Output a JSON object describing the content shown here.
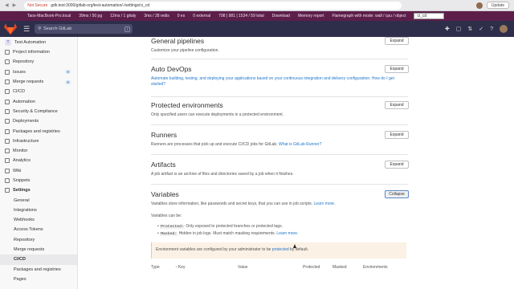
{
  "browser": {
    "not_secure": "Not Secure",
    "url": "gdk.test:3000/gitlab-org/test-automation/-/settings/ci_cd",
    "update": "Update"
  },
  "perf": {
    "items": [
      "Taos-MacBook-Pro.local",
      "39ms / 50 pg",
      "12ms / 1 gitaly",
      "3ms / 28 redis",
      "0 es",
      "0 external",
      "798 | 981 | 1534 / 59 total",
      "Download",
      "Memory report",
      "Flamegraph with mode: wall / cpu / object"
    ],
    "select": "ci_cd"
  },
  "search": {
    "placeholder": "Search GitLab",
    "shortcut": "/"
  },
  "sidebar": {
    "project_initial": "T",
    "project_name": "Test Automation",
    "items": [
      {
        "label": "Project information",
        "sub": false
      },
      {
        "label": "Repository",
        "sub": false
      },
      {
        "label": "Issues",
        "sub": false,
        "badge": "0"
      },
      {
        "label": "Merge requests",
        "sub": false,
        "badge": "0"
      },
      {
        "label": "CI/CD",
        "sub": false
      },
      {
        "label": "Automation",
        "sub": false
      },
      {
        "label": "Security & Compliance",
        "sub": false
      },
      {
        "label": "Deployments",
        "sub": false
      },
      {
        "label": "Packages and registries",
        "sub": false
      },
      {
        "label": "Infrastructure",
        "sub": false
      },
      {
        "label": "Monitor",
        "sub": false
      },
      {
        "label": "Analytics",
        "sub": false
      },
      {
        "label": "Wiki",
        "sub": false
      },
      {
        "label": "Snippets",
        "sub": false
      },
      {
        "label": "Settings",
        "sub": false,
        "bold": true
      },
      {
        "label": "General",
        "sub": true
      },
      {
        "label": "Integrations",
        "sub": true
      },
      {
        "label": "Webhooks",
        "sub": true
      },
      {
        "label": "Access Tokens",
        "sub": true
      },
      {
        "label": "Repository",
        "sub": true
      },
      {
        "label": "Merge requests",
        "sub": true
      },
      {
        "label": "CI/CD",
        "sub": true,
        "active": true
      },
      {
        "label": "Packages and registries",
        "sub": true
      },
      {
        "label": "Pages",
        "sub": true
      }
    ]
  },
  "sections": {
    "general": {
      "title": "General pipelines",
      "desc": "Customize your pipeline configuration.",
      "button": "Expand"
    },
    "autodevops": {
      "title": "Auto DevOps",
      "desc": "Automate building, testing, and deploying your applications based on your continuous integration and delivery configuration.",
      "link": "How do I get started?",
      "button": "Expand"
    },
    "protected": {
      "title": "Protected environments",
      "desc": "Only specified users can execute deployments in a protected environment.",
      "button": "Expand"
    },
    "runners": {
      "title": "Runners",
      "desc": "Runners are processes that pick up and execute CI/CD jobs for GitLab.",
      "link": "What is GitLab Runner?",
      "button": "Expand"
    },
    "artifacts": {
      "title": "Artifacts",
      "desc": "A job artifact is an archive of files and directories saved by a job when it finishes.",
      "button": "Expand"
    },
    "variables": {
      "title": "Variables",
      "desc": "Variables store information, like passwords and secret keys, that you can use in job scripts.",
      "link": "Learn more.",
      "button": "Collapse",
      "can_be": "Variables can be:",
      "b1_code": "Protected:",
      "b1_text": "Only exposed to protected branches or protected tags.",
      "b2_code": "Masked:",
      "b2_text": "Hidden in job logs. Must match masking requirements.",
      "b2_link": "Learn more.",
      "alert_pre": "Environment variables are configured by your administrator to be",
      "alert_link": "protected",
      "alert_post": "by default.",
      "cols": [
        "Type",
        "↑ Key",
        "Value",
        "Protected",
        "Masked",
        "Environments"
      ]
    }
  }
}
